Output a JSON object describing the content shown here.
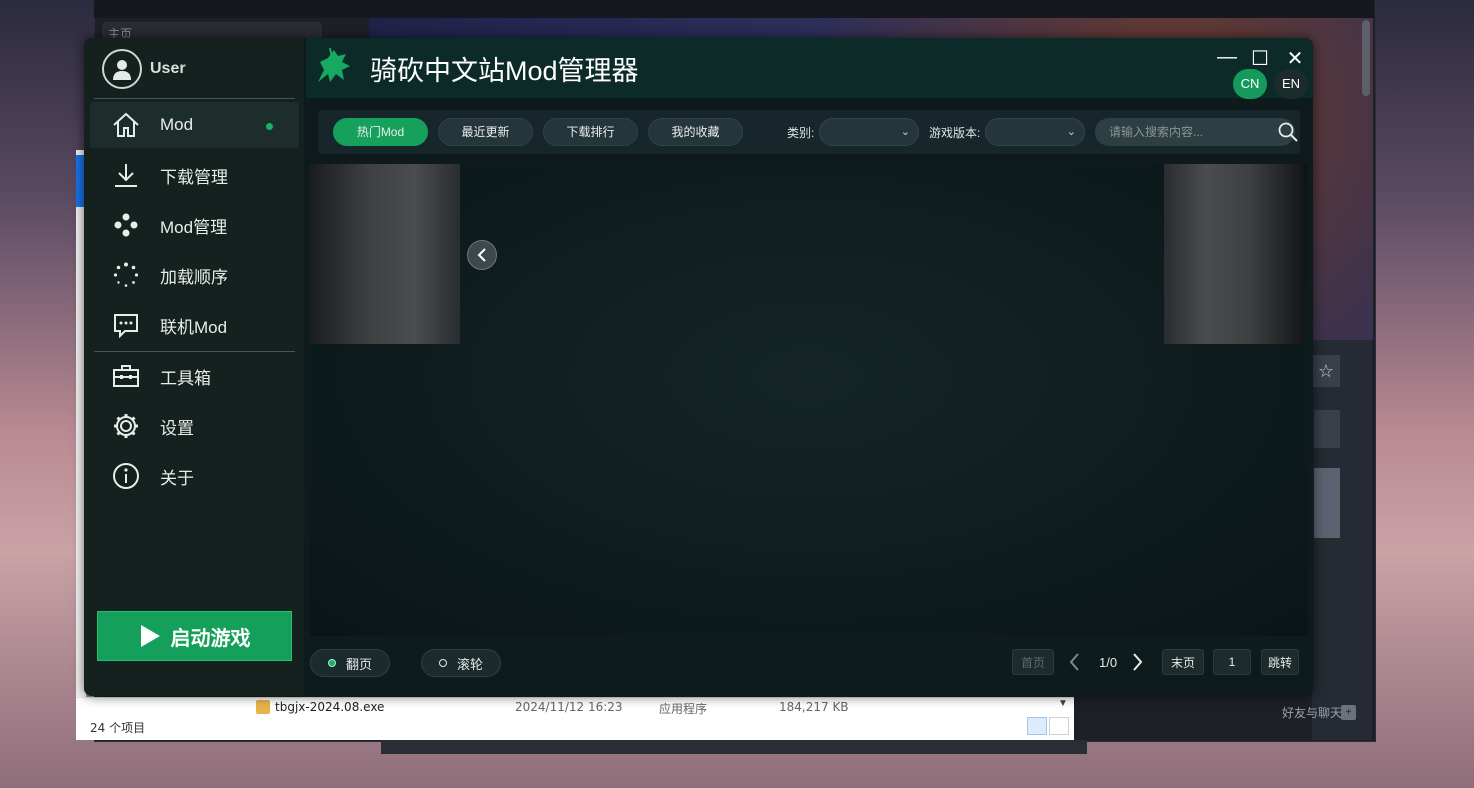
{
  "background": {
    "browser_search_text": "主页",
    "friends_chat": "好友与聊天"
  },
  "explorer": {
    "file": {
      "name": "tbgjx-2024.08.exe",
      "date": "2024/11/12 16:23",
      "type": "应用程序",
      "size": "184,217 KB"
    },
    "item_count": "24 个项目"
  },
  "app": {
    "title": "骑砍中文站Mod管理器",
    "user": {
      "name": "User"
    },
    "window_controls": {
      "minimize": "—",
      "maximize": "☐",
      "close": "✕"
    },
    "languages": [
      "CN",
      "EN"
    ],
    "active_language": "CN",
    "accent_color": "#15a05c",
    "nav": [
      {
        "label": "Mod",
        "icon": "home-icon",
        "active": true
      },
      {
        "label": "下载管理",
        "icon": "download-icon"
      },
      {
        "label": "Mod管理",
        "icon": "mod-manage-icon"
      },
      {
        "label": "加载顺序",
        "icon": "loading-order-icon"
      },
      {
        "label": "联机Mod",
        "icon": "chat-icon"
      },
      {
        "label": "工具箱",
        "icon": "toolbox-icon"
      },
      {
        "label": "设置",
        "icon": "settings-icon"
      },
      {
        "label": "关于",
        "icon": "info-icon"
      }
    ],
    "launch_button": "启动游戏",
    "filters": {
      "tabs": [
        "热门Mod",
        "最近更新",
        "下载排行",
        "我的收藏"
      ],
      "active_tab": "热门Mod",
      "category_label": "类别:",
      "category_value": "",
      "version_label": "游戏版本:",
      "version_value": "",
      "search_placeholder": "请输入搜索内容..."
    },
    "bottom": {
      "mode_page": "翻页",
      "mode_scroll": "滚轮",
      "active_mode": "翻页",
      "first_page": "首页",
      "page_indicator": "1/0",
      "last_page": "末页",
      "page_input": "1",
      "jump": "跳转"
    }
  }
}
